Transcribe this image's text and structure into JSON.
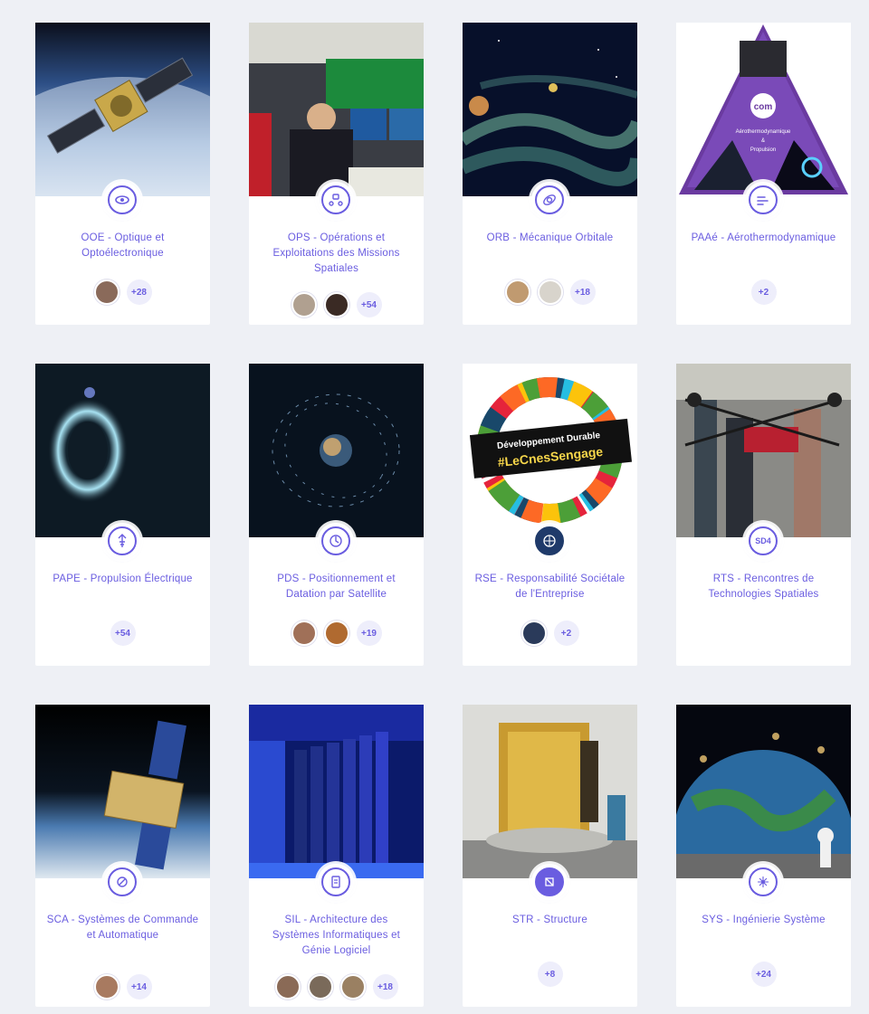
{
  "cards": [
    {
      "title": "OOE - Optique et Optoélectronique",
      "count": "+28",
      "avatars": 1
    },
    {
      "title": "OPS - Opérations et Exploitations des Missions Spatiales",
      "count": "+54",
      "avatars": 2
    },
    {
      "title": "ORB - Mécanique Orbitale",
      "count": "+18",
      "avatars": 2
    },
    {
      "title": "PAAé - Aérothermodynamique",
      "count": "+2",
      "avatars": 0
    },
    {
      "title": "PAPE - Propulsion Électrique",
      "count": "+54",
      "avatars": 0
    },
    {
      "title": "PDS - Positionnement et Datation par Satellite",
      "count": "+19",
      "avatars": 2
    },
    {
      "title": "RSE - Responsabilité Sociétale de l'Entreprise",
      "count": "+2",
      "avatars": 1
    },
    {
      "title": "RTS - Rencontres de Technologies Spatiales",
      "count": "",
      "avatars": 0
    },
    {
      "title": "SCA - Systèmes de Commande et Automatique",
      "count": "+14",
      "avatars": 1
    },
    {
      "title": "SIL - Architecture des Systèmes Informatiques et Génie Logiciel",
      "count": "+18",
      "avatars": 3
    },
    {
      "title": "STR - Structure",
      "count": "+8",
      "avatars": 0
    },
    {
      "title": "SYS - Ingénierie Système",
      "count": "+24",
      "avatars": 0
    }
  ],
  "images": {
    "paae_logo": "com",
    "paae_line1": "Aérothermodynamique",
    "paae_line2": "&",
    "paae_line3": "Propulsion",
    "rse_line1": "Développement Durable",
    "rse_line2": "#LeCnesSengage",
    "rts_badge": "SD4"
  },
  "colors": {
    "accent": "#6a5de0",
    "background": "#eef0f5",
    "card": "#ffffff"
  }
}
